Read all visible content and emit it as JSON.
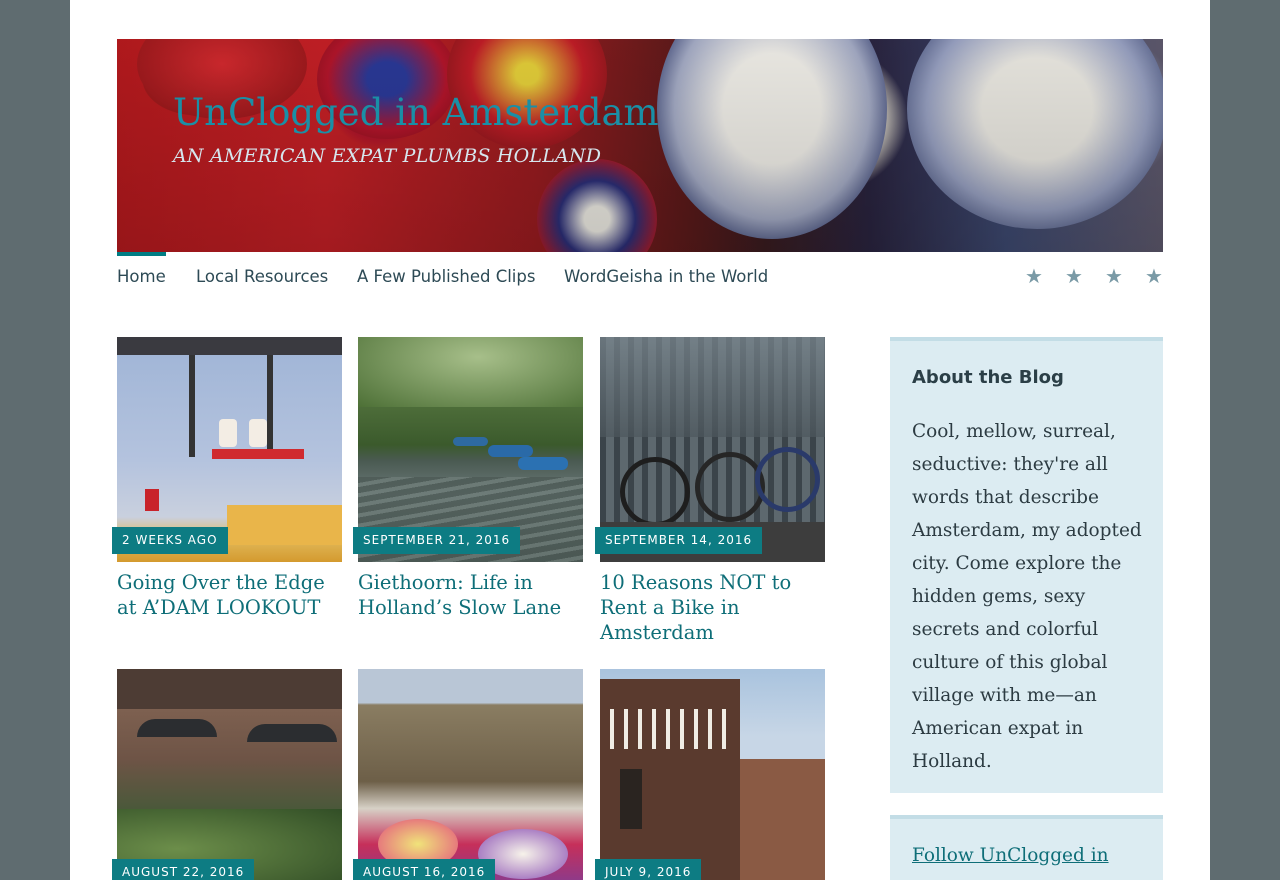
{
  "site": {
    "title": "UnClogged in Amsterdam",
    "tagline": "AN AMERICAN EXPAT PLUMBS HOLLAND"
  },
  "nav": {
    "items": [
      {
        "label": "Home",
        "active": true
      },
      {
        "label": "Local Resources"
      },
      {
        "label": "A Few Published Clips"
      },
      {
        "label": "WordGeisha in the World"
      }
    ],
    "social_icons": [
      "star-icon",
      "star-icon",
      "star-icon",
      "star-icon"
    ],
    "social_glyph": "★"
  },
  "posts": [
    {
      "date": "2 WEEKS AGO",
      "title": "Going Over the Edge at A’DAM LOOKOUT",
      "image": "swing-photo"
    },
    {
      "date": "SEPTEMBER 21, 2016",
      "title": "Giethoorn: Life in Holland’s Slow Lane",
      "image": "canal-photo"
    },
    {
      "date": "SEPTEMBER 14, 2016",
      "title": "10 Reasons NOT to Rent a Bike in Amsterdam",
      "image": "bikes-photo"
    },
    {
      "date": "AUGUST 22, 2016",
      "title": "",
      "image": "cafe-photo"
    },
    {
      "date": "AUGUST 16, 2016",
      "title": "",
      "image": "flower-carpet-photo"
    },
    {
      "date": "JULY 9, 2016",
      "title": "",
      "image": "moco-museum-photo"
    }
  ],
  "sidebar": {
    "about_title": "About the Blog",
    "about_text": "Cool, mellow, surreal, seductive: they're all words that describe Amsterdam, my adopted city. Come explore the hidden gems, sexy secrets and colorful culture of this global village with me—an American expat in Holland.",
    "follow_label": "Follow UnClogged in"
  },
  "colors": {
    "accent": "#0d7c83",
    "title_link": "#1a8fa6",
    "sidebar_bg": "#dcecf2",
    "outer_bg": "#5f6c70"
  }
}
